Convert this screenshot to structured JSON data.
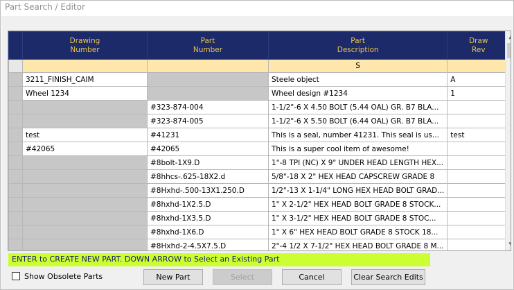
{
  "window": {
    "title": "Part Search / Editor"
  },
  "grid": {
    "columns": [
      {
        "label1": "Drawing",
        "label2": "Number"
      },
      {
        "label1": "Part",
        "label2": "Number"
      },
      {
        "label1": "Part",
        "label2": "Description"
      },
      {
        "label1": "Draw",
        "label2": "Rev"
      }
    ],
    "filter": {
      "drawing": "",
      "part": "",
      "description": "S",
      "rev": ""
    },
    "rows": [
      {
        "drawing": "3211_FINISH_CAIM",
        "part": "",
        "description": "Steele object",
        "rev": "A"
      },
      {
        "drawing": "Wheel 1234",
        "part": "",
        "description": "Wheel design #1234",
        "rev": "1"
      },
      {
        "drawing": "",
        "part": "#323-874-004",
        "description": "1-1/2\"-6 X 4.50 BOLT (5.44 OAL) GR. B7 BLA...",
        "rev": ""
      },
      {
        "drawing": "",
        "part": "#323-874-005",
        "description": "1-1/2\"-6 X 5.50 BOLT (6.44 OAL) GR. B7 BLA...",
        "rev": ""
      },
      {
        "drawing": "test",
        "part": "#41231",
        "description": "This is a seal, number 41231. This seal is us...",
        "rev": "test"
      },
      {
        "drawing": "#42065",
        "part": "#42065",
        "description": "This is a super cool item of awesome!",
        "rev": ""
      },
      {
        "drawing": "",
        "part": "#8bolt-1X9.D",
        "description": "1\"-8 TPI (NC) X 9\" UNDER HEAD LENGTH HEX...",
        "rev": ""
      },
      {
        "drawing": "",
        "part": "#8hhcs-.625-18X2.d",
        "description": "5/8\"-18 X 2\" HEX HEAD CAPSCREW GRADE 8",
        "rev": ""
      },
      {
        "drawing": "",
        "part": "#8Hxhd-.500-13X1.250.D",
        "description": "1/2\"-13 X 1-1/4\" LONG HEX HEAD BOLT GRAD...",
        "rev": ""
      },
      {
        "drawing": "",
        "part": "#8hxhd-1X2.5.D",
        "description": "1\" X 2-1/2\" HEX HEAD BOLT GRADE 8    STOCK...",
        "rev": ""
      },
      {
        "drawing": "",
        "part": "#8hxhd-1X3.5.D",
        "description": "1\" X 3-1/2\" HEX HEAD BOLT GRADE 8    STOC...",
        "rev": ""
      },
      {
        "drawing": "",
        "part": "#8hxhd-1X6.D",
        "description": "1\" X 6\" HEX HEAD BOLT GRADE 8   STOCK 18...",
        "rev": ""
      },
      {
        "drawing": "",
        "part": "#8Hxhd-2-4.5X7.5.D",
        "description": "2\"-4 1/2 X 7-1/2\" HEX HEAD BOLT GRADE 8 M...",
        "rev": ""
      }
    ]
  },
  "status": {
    "message": "ENTER to CREATE NEW PART.   DOWN ARROW to Select an Existing Part"
  },
  "options": {
    "show_obsolete_label": "Show Obsolete Parts",
    "show_obsolete_checked": false
  },
  "buttons": {
    "new_part": "New Part",
    "select": "Select",
    "cancel": "Cancel",
    "clear": "Clear Search Edits"
  }
}
